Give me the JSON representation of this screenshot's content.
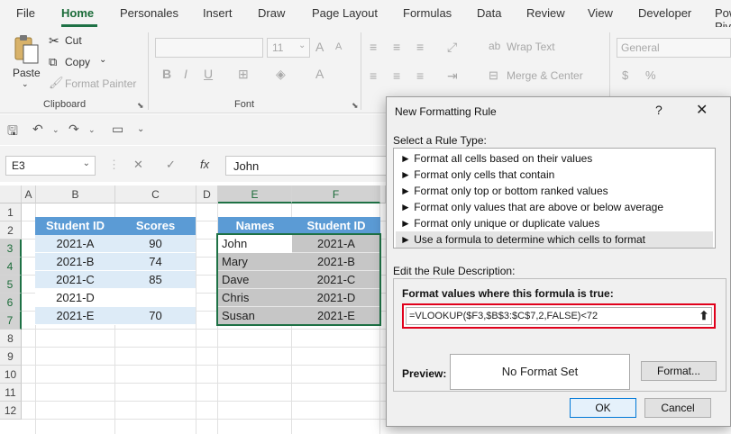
{
  "menu": [
    "File",
    "Home",
    "Personales",
    "Insert",
    "Draw",
    "Page Layout",
    "Formulas",
    "Data",
    "Review",
    "View",
    "Developer",
    "Power Pivot"
  ],
  "ribbon": {
    "clipboard": {
      "paste": "Paste",
      "cut": "Cut",
      "copy": "Copy",
      "format_painter": "Format Painter",
      "label": "Clipboard"
    },
    "font": {
      "size": "11",
      "label": "Font"
    },
    "alignment": {
      "wrap_text": "Wrap Text",
      "merge_center": "Merge & Center"
    },
    "number": {
      "format": "General"
    }
  },
  "formula_bar": {
    "name_box": "E3",
    "cancel": "✕",
    "enter": "✓",
    "fx": "fx",
    "content": "John"
  },
  "grid": {
    "columns": [
      "A",
      "B",
      "C",
      "D",
      "E",
      "F"
    ],
    "rows": [
      "1",
      "2",
      "3",
      "4",
      "5",
      "6",
      "7",
      "8",
      "9",
      "10",
      "11",
      "12"
    ],
    "table1": {
      "headers": [
        "Student ID",
        "Scores"
      ],
      "rows": [
        [
          "2021-A",
          "90"
        ],
        [
          "2021-B",
          "74"
        ],
        [
          "2021-C",
          "85"
        ],
        [
          "2021-D",
          ""
        ],
        [
          "2021-E",
          "70"
        ]
      ]
    },
    "table2": {
      "headers": [
        "Names",
        "Student ID"
      ],
      "rows": [
        [
          "John",
          "2021-A"
        ],
        [
          "Mary",
          "2021-B"
        ],
        [
          "Dave",
          "2021-C"
        ],
        [
          "Chris",
          "2021-D"
        ],
        [
          "Susan",
          "2021-E"
        ]
      ]
    }
  },
  "dialog": {
    "title": "New Formatting Rule",
    "help": "?",
    "close": "✕",
    "select_label": "Select a Rule Type:",
    "rule_types": [
      "► Format all cells based on their values",
      "► Format only cells that contain",
      "► Format only top or bottom ranked values",
      "► Format only values that are above or below average",
      "► Format only unique or duplicate values",
      "► Use a formula to determine which cells to format"
    ],
    "edit_label": "Edit the Rule Description:",
    "formula_label": "Format values where this formula is true:",
    "formula": "=VLOOKUP($F3,$B$3:$C$7,2,FALSE)<72",
    "preview_label": "Preview:",
    "preview_text": "No Format Set",
    "format_button": "Format...",
    "ok": "OK",
    "cancel": "Cancel"
  },
  "colors": {
    "accent": "#1e7145",
    "table_header": "#5b9bd5",
    "table_row": "#ddebf7",
    "highlight": "#e0001b"
  }
}
